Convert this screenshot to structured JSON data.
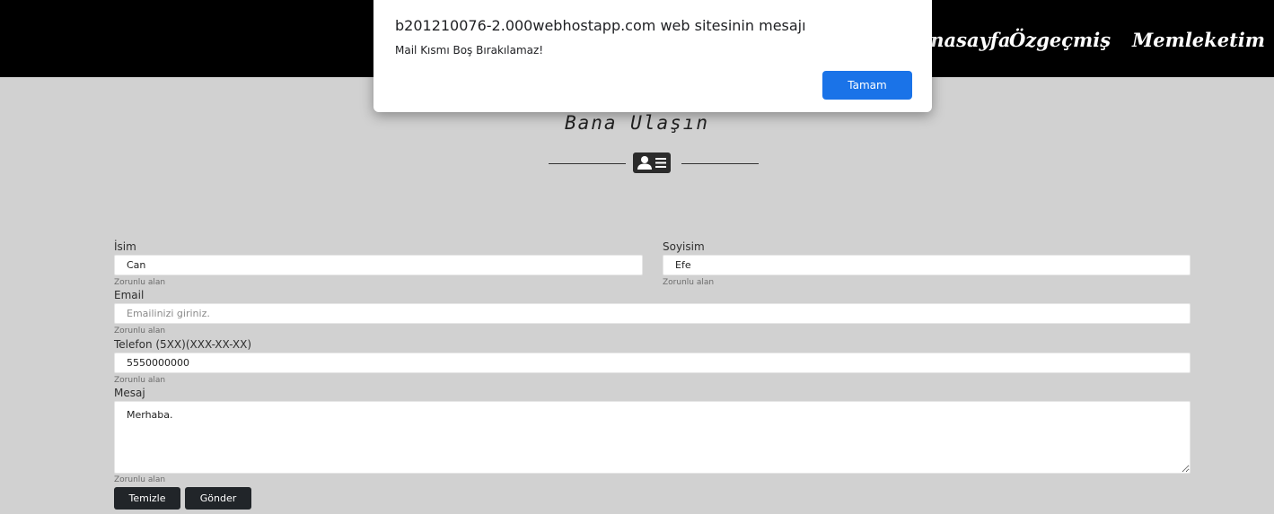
{
  "nav": {
    "items": [
      {
        "label": "Anasayfa"
      },
      {
        "label": "Özgeçmiş"
      },
      {
        "label": "Memleketim"
      }
    ]
  },
  "page": {
    "title": "Bana Ulaşın",
    "icon": "contact-card-icon"
  },
  "form": {
    "first_name": {
      "label": "İsim",
      "value": "Can",
      "helper": "Zorunlu alan"
    },
    "last_name": {
      "label": "Soyisim",
      "value": "Efe",
      "helper": "Zorunlu alan"
    },
    "email": {
      "label": "Email",
      "value": "",
      "placeholder": "Emailinizi giriniz.",
      "helper": "Zorunlu alan"
    },
    "phone": {
      "label": "Telefon (5XX)(XXX-XX-XX)",
      "value": "5550000000",
      "helper": "Zorunlu alan"
    },
    "message": {
      "label": "Mesaj",
      "value": "Merhaba.",
      "helper": "Zorunlu alan"
    },
    "clear_label": "Temizle",
    "submit_label": "Gönder"
  },
  "dialog": {
    "title": "b201210076-2.000webhostapp.com web sitesinin mesajı",
    "message": "Mail Kısmı Boş Bırakılamaz!",
    "ok_label": "Tamam"
  },
  "colors": {
    "navbar": "#000000",
    "page_bg": "#d1d1d1",
    "button": "#212529",
    "dialog_ok": "#1a73e8"
  }
}
